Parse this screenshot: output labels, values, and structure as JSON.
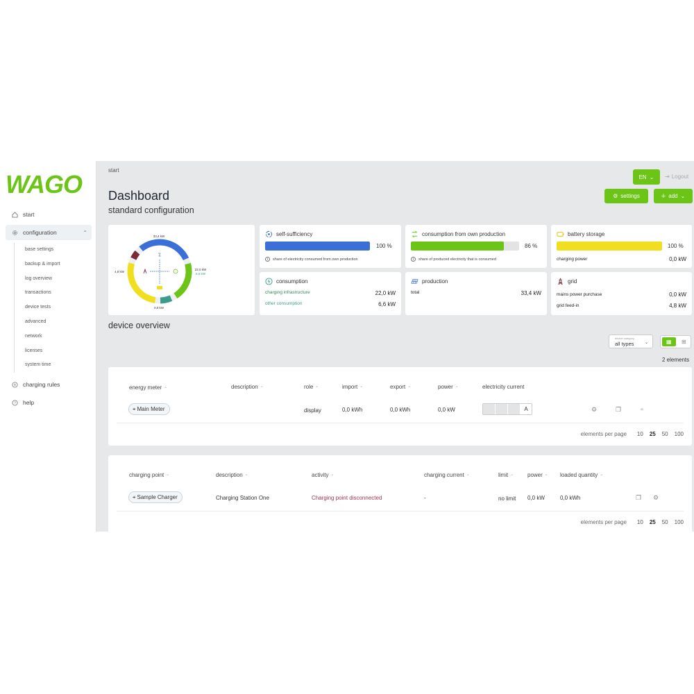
{
  "brand": {
    "logo_text": "WAGO",
    "accent": "#6cc417"
  },
  "sidebar": {
    "items": [
      {
        "label": "start",
        "icon": "home-icon"
      },
      {
        "label": "configuration",
        "icon": "gear-icon"
      },
      {
        "label": "charging rules",
        "icon": "bolt-circle-icon"
      },
      {
        "label": "help",
        "icon": "question-icon"
      }
    ],
    "sub_items": [
      "base settings",
      "backup & import",
      "log overview",
      "transactions",
      "device tests",
      "advanced",
      "network",
      "licenses",
      "system time"
    ]
  },
  "header": {
    "breadcrumb": "start",
    "title": "Dashboard",
    "subtitle": "standard configuration",
    "language": "EN",
    "logout": "Logout",
    "settings": "settings",
    "add": "add"
  },
  "energy_flow": {
    "top": "33,4 kW",
    "left": "4,8 kW",
    "right_1": "22,0 kW",
    "right_2": "6,6 kW",
    "bottom": "0,0 kW",
    "segments": [
      {
        "name": "production",
        "color": "#3b6fd8",
        "share": 0.29
      },
      {
        "name": "consumption",
        "color": "#6cc417",
        "share": 0.2
      },
      {
        "name": "other",
        "color": "#3b9c8c",
        "share": 0.06
      },
      {
        "name": "battery",
        "color": "#f1df1f",
        "share": 0.27
      },
      {
        "name": "grid",
        "color": "#7b2a3a",
        "share": 0.04
      }
    ]
  },
  "kpis": {
    "self_sufficiency": {
      "title": "self-sufficiency",
      "value": 100,
      "value_label": "100 %",
      "note": "share of electricity consumed from own production",
      "color": "#3b6fd8"
    },
    "own_production": {
      "title": "consumption from own production",
      "value": 86,
      "value_label": "86 %",
      "note": "share of produced electricity that is consumed",
      "color": "#6cc417"
    },
    "battery": {
      "title": "battery storage",
      "value": 100,
      "value_label": "100 %",
      "row_label": "charging power",
      "row_value": "0,0 kW",
      "color": "#f1df1f"
    },
    "consumption": {
      "title": "consumption",
      "row1_label": "charging infrastructure",
      "row1_value": "22,0 kW",
      "row2_label": "other consumption",
      "row2_value": "6,6 kW"
    },
    "production": {
      "title": "production",
      "row_label": "total",
      "row_value": "33,4 kW"
    },
    "grid": {
      "title": "grid",
      "row1_label": "mains power purchase",
      "row1_value": "0,0 kW",
      "row2_label": "grid feed-in",
      "row2_value": "4,8 kW"
    }
  },
  "devices": {
    "title": "device overview",
    "filter_label": "device category",
    "filter_value": "all types",
    "count": "2 elements"
  },
  "meter_table": {
    "headers": [
      "energy meter",
      "description",
      "role",
      "import",
      "export",
      "power",
      "electricity current"
    ],
    "row": {
      "name": "Main Meter",
      "description": "",
      "role": "display",
      "import": "0,0  kWh",
      "export": "0,0  kWh",
      "power": "0,0 kW",
      "current_unit": "A"
    },
    "pager": {
      "label": "elements per page",
      "options": [
        "10",
        "25",
        "50",
        "100"
      ],
      "selected": "25"
    }
  },
  "charger_table": {
    "headers": [
      "charging point",
      "description",
      "activity",
      "charging current",
      "limit",
      "power",
      "loaded quantity"
    ],
    "row": {
      "name": "Sample Charger",
      "description": "Charging Station One",
      "activity": "Charging point disconnected",
      "charging_current": "-",
      "limit": "no limit",
      "power": "0,0 kW",
      "loaded_quantity": "0,0 kWh"
    },
    "pager": {
      "label": "elements per page",
      "options": [
        "10",
        "25",
        "50",
        "100"
      ],
      "selected": "25"
    }
  }
}
